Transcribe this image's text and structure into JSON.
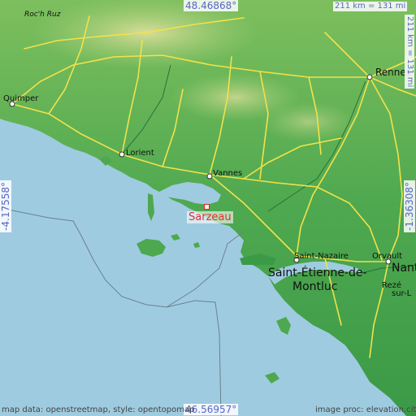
{
  "coordinates": {
    "north": "48.46868°",
    "south": "46.56957°",
    "west": "-4.17558°",
    "east": "-1.36308°"
  },
  "scale": {
    "horizontal": "211 km = 131 mi",
    "vertical": "211 km = 131 mi"
  },
  "highlight": {
    "name": "Sarzeau",
    "color": "#e03030"
  },
  "places": {
    "rochruz": "Roc'h Ruz",
    "quimper": "Quimper",
    "lorient": "Lorient",
    "vannes": "Vannes",
    "rennes": "Rennes",
    "saintnazaire": "Saint-Nazaire",
    "saintetienne": "Saint-Étienne-de-",
    "montluc": "Montluc",
    "orvault": "Orvault",
    "nantes": "Nant",
    "reze": "Rezé",
    "surloire": "sur-L"
  },
  "credits": {
    "left": "map data: openstreetmap, style: opentopomap",
    "right": "image proc: elevation.city"
  },
  "colors": {
    "sea": "#9fcbe0",
    "lowland": "#3e9e4a",
    "midland": "#6fb85a",
    "highland": "#c9d88a",
    "road": "#f2e24a"
  }
}
